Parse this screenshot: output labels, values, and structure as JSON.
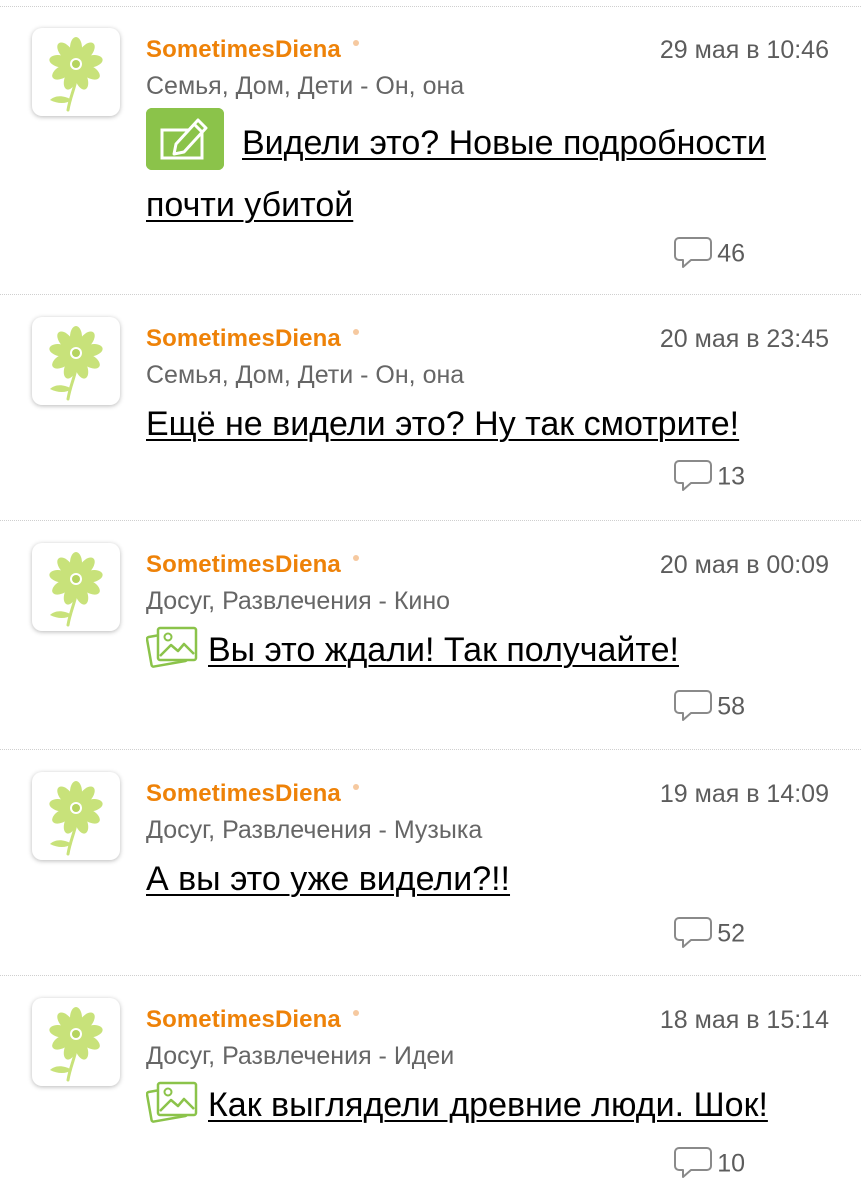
{
  "colors": {
    "username": "#ee8208",
    "meta_text": "#666666",
    "accent_green": "#8bc34a",
    "flower_green": "#c8e27a"
  },
  "posts": [
    {
      "author": "SometimesDiena",
      "timestamp": "29 мая в 10:46",
      "category": "Семья, Дом, Дети - Он, она",
      "type_icon": "poll-icon",
      "title": "Видели это? Новые подробности почти убитой",
      "comments": "46"
    },
    {
      "author": "SometimesDiena",
      "timestamp": "20 мая в 23:45",
      "category": "Семья, Дом, Дети - Он, она",
      "type_icon": "",
      "title": "Ещё не видели это? Ну так смотрите!",
      "comments": "13"
    },
    {
      "author": "SometimesDiena",
      "timestamp": "20 мая в 00:09",
      "category": "Досуг, Развлечения - Кино",
      "type_icon": "photo-icon",
      "title": "Вы это ждали! Так получайте!",
      "comments": "58"
    },
    {
      "author": "SometimesDiena",
      "timestamp": "19 мая в 14:09",
      "category": "Досуг, Развлечения - Музыка",
      "type_icon": "",
      "title": "А вы это уже видели?!!",
      "comments": "52"
    },
    {
      "author": "SometimesDiena",
      "timestamp": "18 мая в 15:14",
      "category": "Досуг, Развлечения - Идеи",
      "type_icon": "photo-icon",
      "title": "Как выглядели древние люди. Шок!",
      "comments": "10"
    }
  ]
}
